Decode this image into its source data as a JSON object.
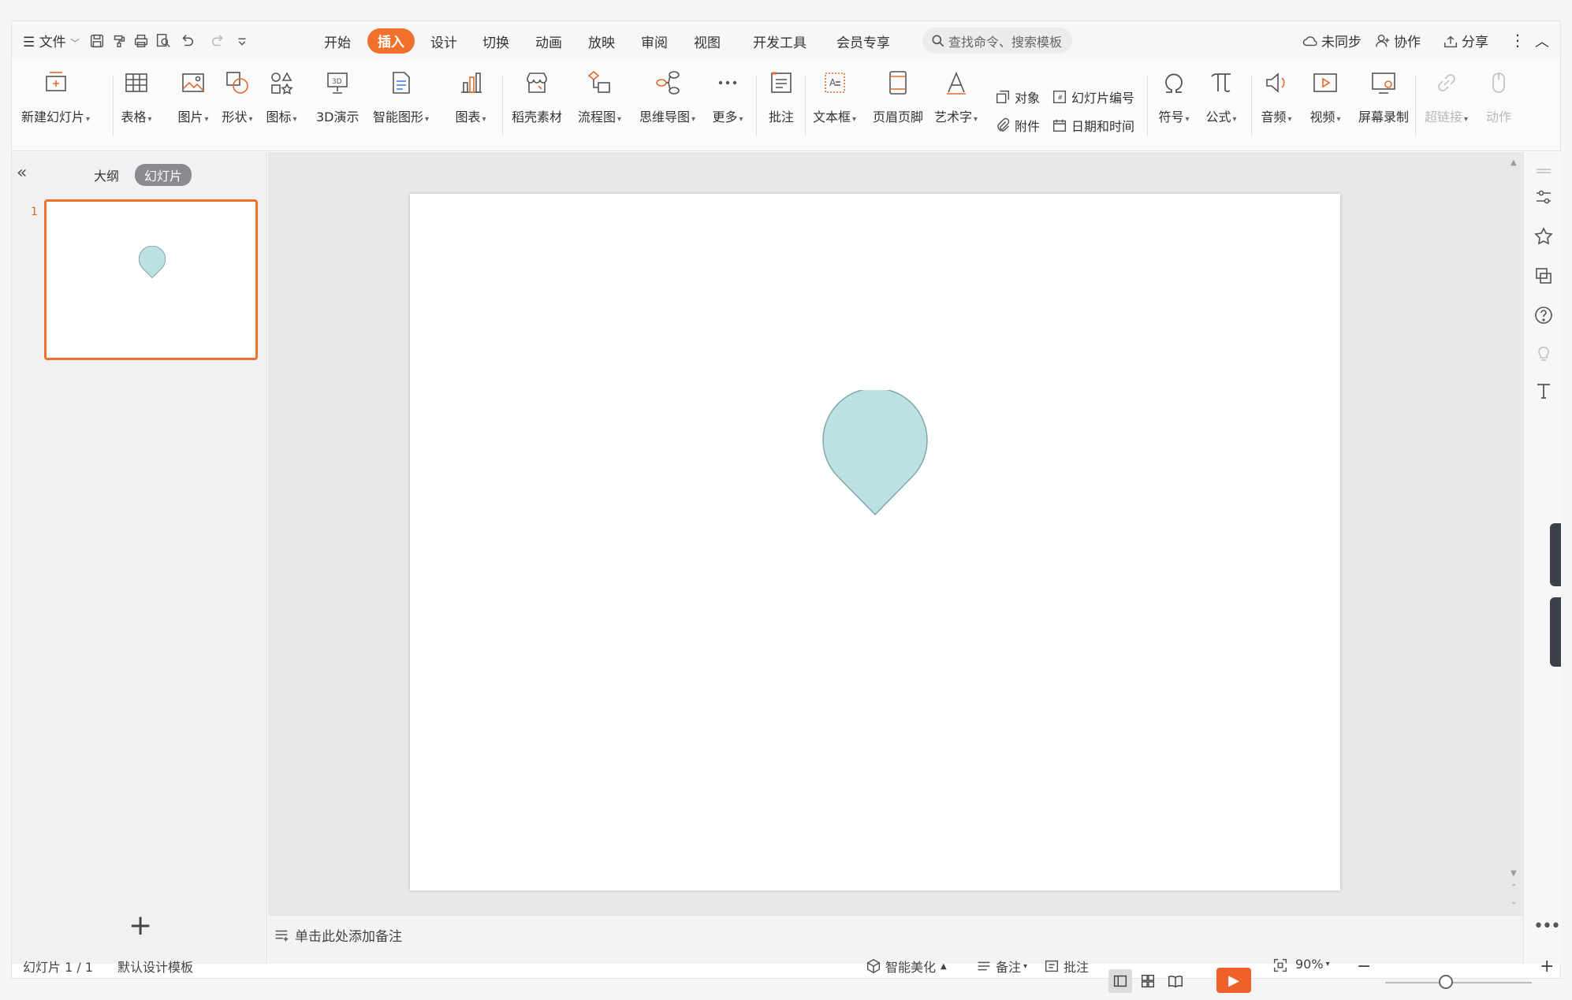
{
  "menubar": {
    "file_label": "文件",
    "tabs": [
      "开始",
      "插入",
      "设计",
      "切换",
      "动画",
      "放映",
      "审阅",
      "视图",
      "开发工具",
      "会员专享"
    ],
    "active_tab": "插入",
    "search_placeholder": "查找命令、搜索模板",
    "sync_label": "未同步",
    "collab_label": "协作",
    "share_label": "分享"
  },
  "ribbon": {
    "new_slide": "新建幻灯片",
    "table": "表格",
    "picture": "图片",
    "shape": "形状",
    "icon": "图标",
    "demo3d": "3D演示",
    "smartart": "智能图形",
    "chart": "图表",
    "material": "稻壳素材",
    "flowchart": "流程图",
    "mindmap": "思维导图",
    "more": "更多",
    "comment": "批注",
    "textbox": "文本框",
    "header_footer": "页眉页脚",
    "wordart": "艺术字",
    "object": "对象",
    "attachment": "附件",
    "slide_number": "幻灯片编号",
    "datetime": "日期和时间",
    "symbol": "符号",
    "formula": "公式",
    "audio": "音频",
    "video": "视频",
    "screen_record": "屏幕录制",
    "hyperlink": "超链接",
    "action": "动作"
  },
  "leftpanel": {
    "outline_tab": "大纲",
    "slides_tab": "幻灯片",
    "slide_number": "1"
  },
  "notes": {
    "placeholder": "单击此处添加备注"
  },
  "statusbar": {
    "slide_info": "幻灯片 1 / 1",
    "template": "默认设计模板",
    "beautify": "智能美化",
    "notes": "备注",
    "comment": "批注",
    "zoom": "90%"
  },
  "colors": {
    "accent": "#f0702c",
    "shape_fill": "#bde0e2",
    "shape_stroke": "#7fa9ad"
  }
}
